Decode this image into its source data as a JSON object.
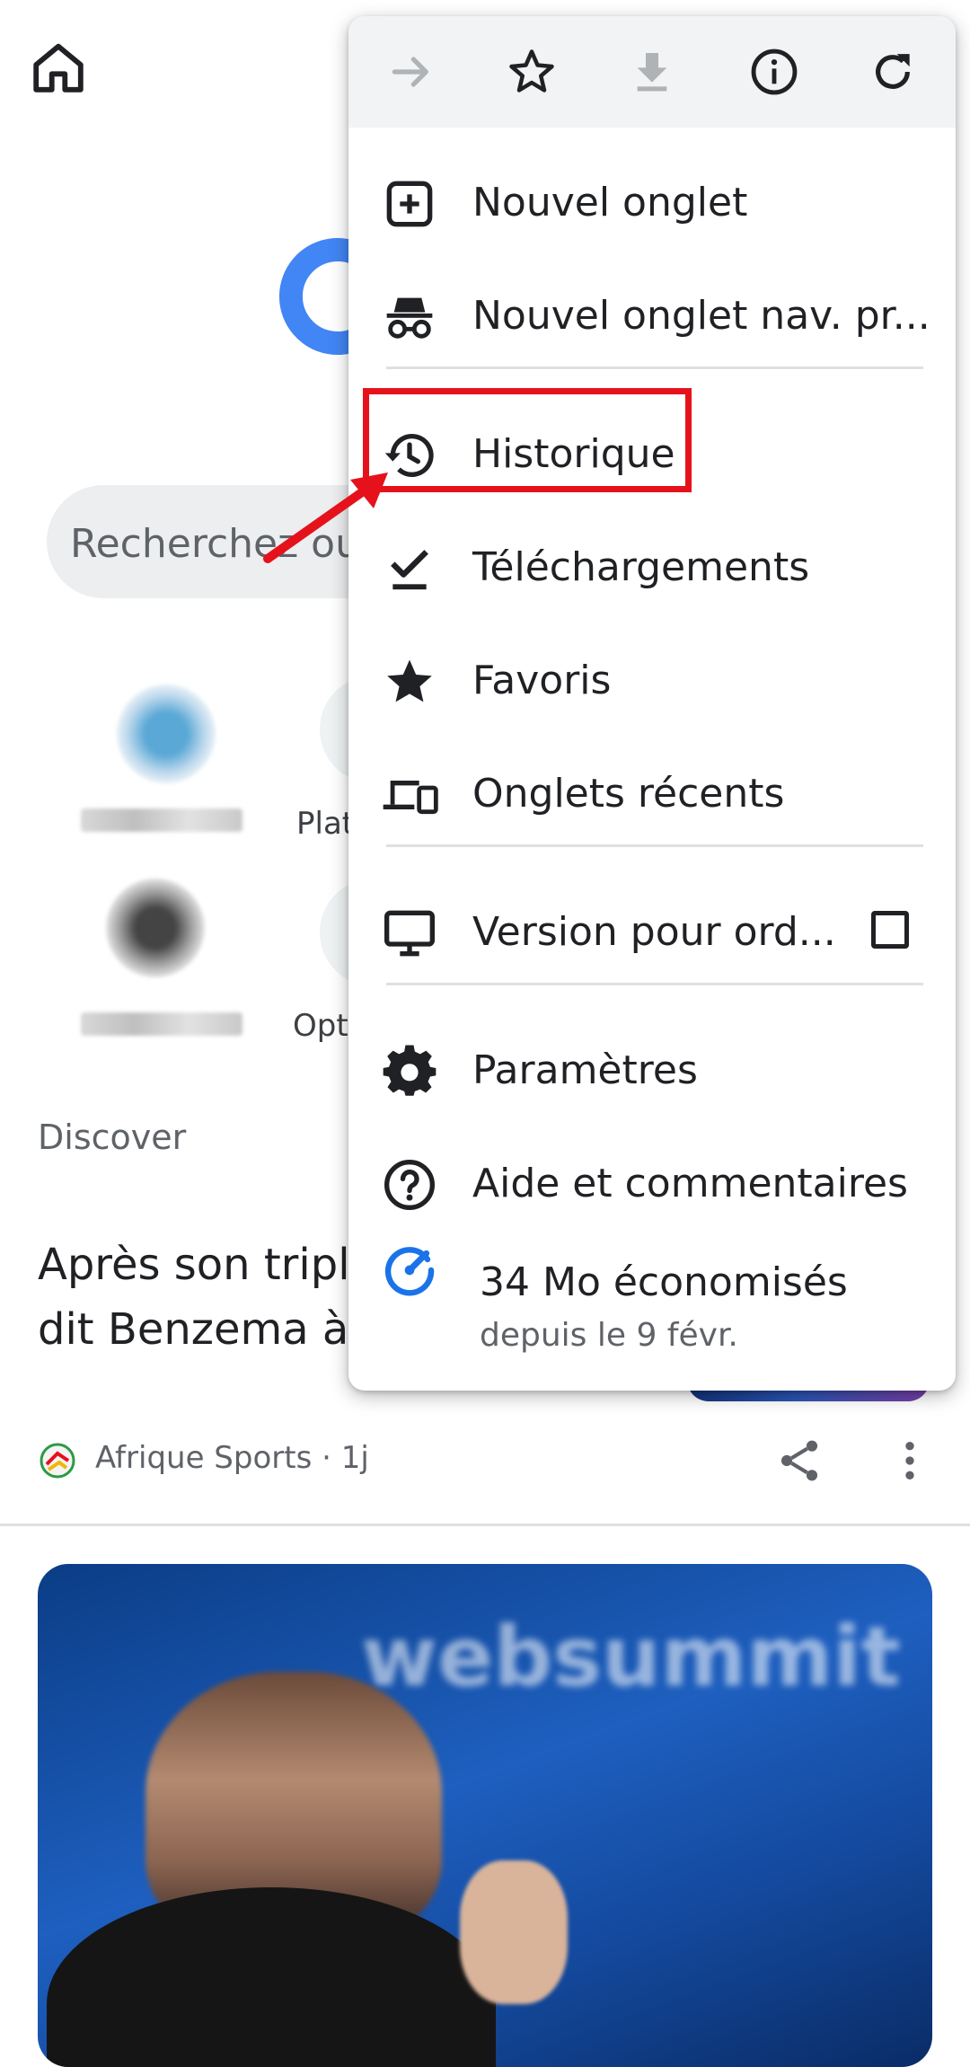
{
  "page": {
    "search": {
      "placeholder": "Recherchez ou s"
    },
    "tiles": [
      {
        "label": ""
      },
      {
        "label": "Plat"
      },
      {
        "label": ""
      },
      {
        "label": "Opti"
      }
    ],
    "discover": {
      "label": "Discover"
    },
    "article": {
      "title_line1": "Après son triple",
      "title_line2": "dit Benzema à l",
      "source": "Afrique Sports · 1j"
    },
    "hero_image": {
      "watermark": "websummit"
    }
  },
  "menu": {
    "toolbar": [
      {
        "icon": "forward-arrow-icon",
        "enabled": false
      },
      {
        "icon": "star-outline-icon",
        "enabled": true
      },
      {
        "icon": "download-icon",
        "enabled": false
      },
      {
        "icon": "info-icon",
        "enabled": true
      },
      {
        "icon": "refresh-icon",
        "enabled": true
      }
    ],
    "items": {
      "new_tab": "Nouvel onglet",
      "incognito": "Nouvel onglet nav. pr...",
      "history": "Historique",
      "downloads": "Téléchargements",
      "bookmarks": "Favoris",
      "recent_tabs": "Onglets récents",
      "desktop_site": "Version pour ord...",
      "settings": "Paramètres",
      "help": "Aide et commentaires"
    },
    "desktop_site_checked": false,
    "savings": {
      "title": "34 Mo économisés",
      "subtitle": "depuis le 9 févr."
    }
  },
  "colors": {
    "accent_blue": "#1a73e8",
    "annotation_red": "#e5121c",
    "toolbar_bg": "#f1f3f4"
  }
}
